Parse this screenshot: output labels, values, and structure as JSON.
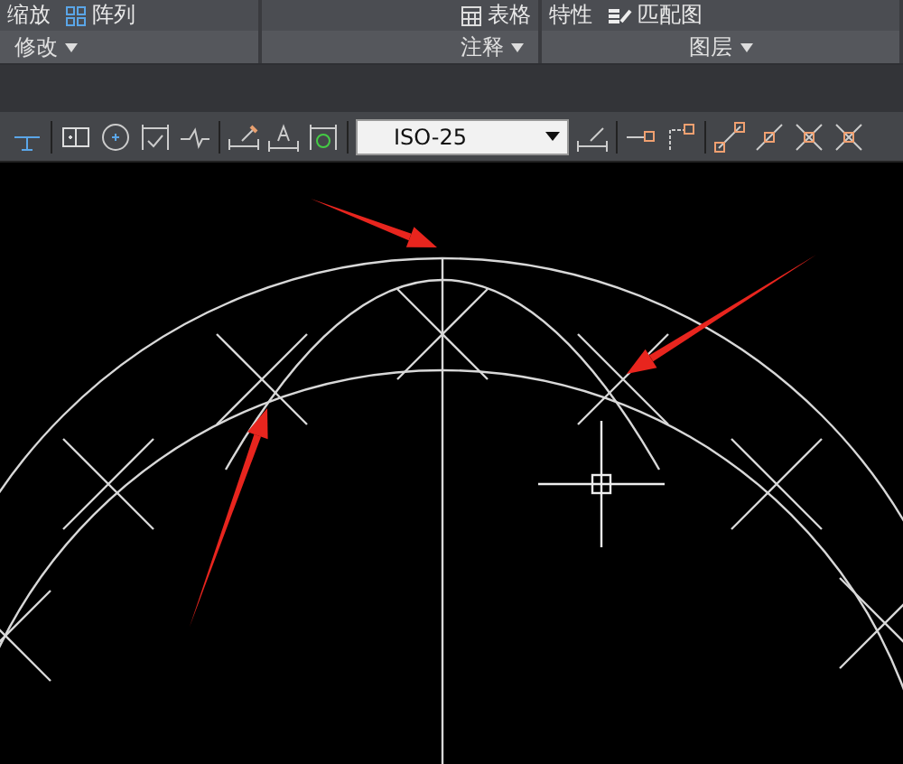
{
  "ribbon": {
    "top_buttons": [
      {
        "label": "缩放",
        "kind": "plain"
      },
      {
        "label": "阵列",
        "kind": "grid"
      },
      {
        "label": "表格",
        "kind": "table"
      },
      {
        "label": "特性",
        "kind": "plain"
      },
      {
        "label": "匹配图",
        "kind": "brush"
      }
    ],
    "panels": [
      {
        "label": "修改"
      },
      {
        "label": "注释"
      },
      {
        "label": "图层"
      }
    ]
  },
  "dimension_toolbar": {
    "style": "ISO-25"
  }
}
